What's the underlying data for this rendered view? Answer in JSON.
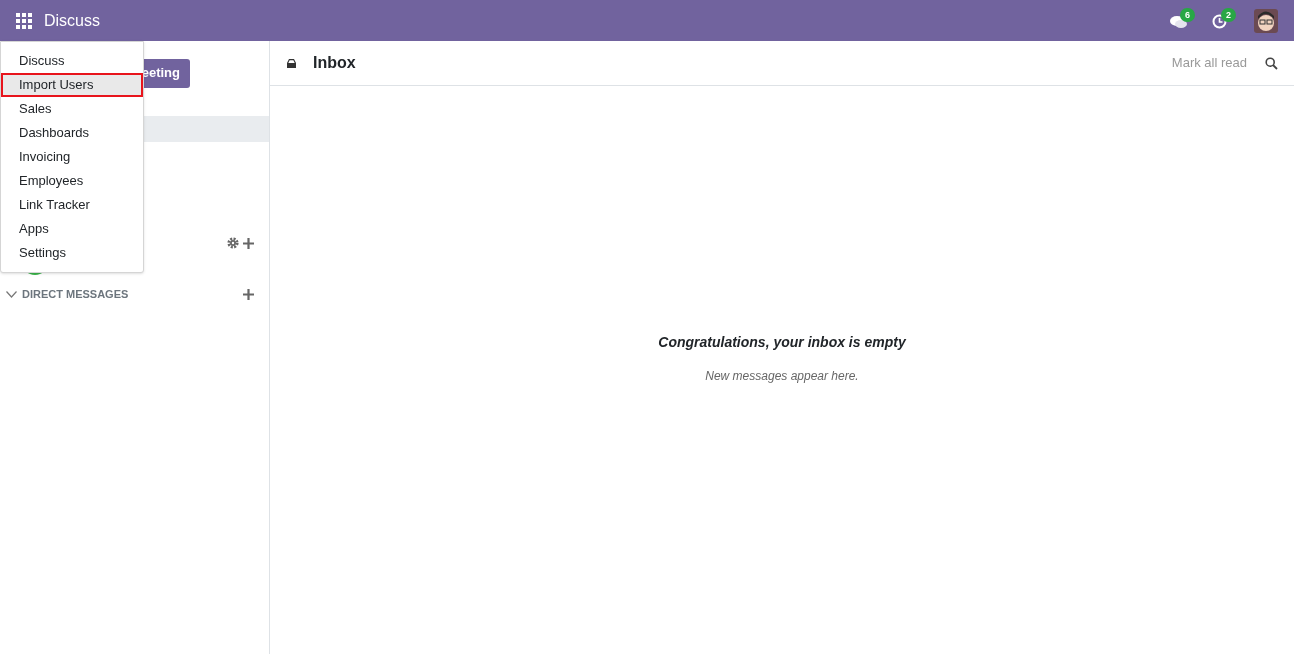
{
  "navbar": {
    "app_title": "Discuss",
    "chat_badge": "6",
    "activity_badge": "2"
  },
  "sidebar": {
    "meeting_button": "eeting",
    "direct_messages": "DIRECT MESSAGES"
  },
  "app_menu": [
    {
      "label": "Discuss",
      "selected": false
    },
    {
      "label": "Import Users",
      "selected": true
    },
    {
      "label": "Sales",
      "selected": false
    },
    {
      "label": "Dashboards",
      "selected": false
    },
    {
      "label": "Invoicing",
      "selected": false
    },
    {
      "label": "Employees",
      "selected": false
    },
    {
      "label": "Link Tracker",
      "selected": false
    },
    {
      "label": "Apps",
      "selected": false
    },
    {
      "label": "Settings",
      "selected": false
    }
  ],
  "content": {
    "title": "Inbox",
    "mark_all_read": "Mark all read",
    "empty_title": "Congratulations, your inbox is empty",
    "empty_hint": "New messages appear here."
  }
}
